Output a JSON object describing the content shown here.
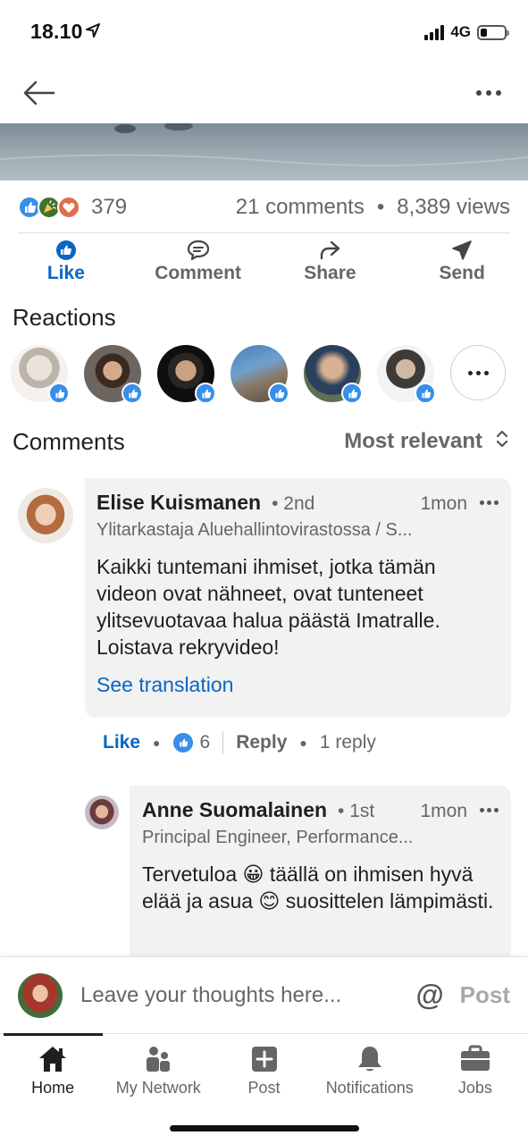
{
  "status": {
    "time": "18.10",
    "network": "4G",
    "battery_level": 0.28
  },
  "post_stats": {
    "reaction_count": "379",
    "comments": "21 comments",
    "dot": "•",
    "views": "8,389 views"
  },
  "actions": {
    "like": "Like",
    "comment": "Comment",
    "share": "Share",
    "send": "Send"
  },
  "reactions_title": "Reactions",
  "comments_title": "Comments",
  "sort_label": "Most relevant",
  "comment1": {
    "name": "Elise Kuismanen",
    "degree": "• 2nd",
    "time": "1mon",
    "headline": "Ylitarkastaja Aluehallintovirastossa / S...",
    "text": "Kaikki tuntemani ihmiset, jotka tämän videon ovat nähneet, ovat tunteneet ylitsevuotavaa halua päästä Imatralle. Loistava rekryvideo!",
    "translate": "See translation",
    "like_label": "Like",
    "like_count": "6",
    "reply_label": "Reply",
    "replies": "1 reply"
  },
  "comment2": {
    "name": "Anne Suomalainen",
    "degree": "• 1st",
    "time": "1mon",
    "headline": "Principal Engineer, Performance...",
    "text": "Tervetuloa 😀 täällä on ihmisen hyvä elää ja asua 😊 suosittelen lämpimästi."
  },
  "composer": {
    "placeholder": "Leave your thoughts here...",
    "at": "@",
    "post": "Post"
  },
  "tabs": [
    {
      "label": "Home",
      "icon": "home-icon"
    },
    {
      "label": "My Network",
      "icon": "network-icon"
    },
    {
      "label": "Post",
      "icon": "post-plus-icon"
    },
    {
      "label": "Notifications",
      "icon": "bell-icon"
    },
    {
      "label": "Jobs",
      "icon": "briefcase-icon"
    }
  ],
  "colors": {
    "accent": "#0a66c2",
    "like_blue": "#378fe9",
    "celebrate_green": "#44712e",
    "love_red": "#df704d",
    "muted": "#666666"
  }
}
